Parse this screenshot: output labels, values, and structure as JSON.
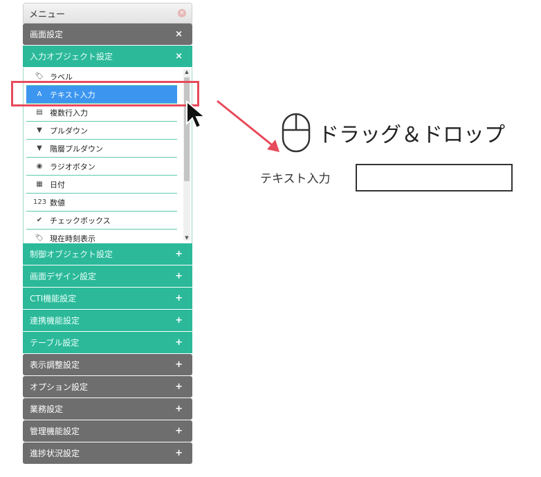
{
  "menu": {
    "title": "メニュー",
    "close_icon": "close-icon",
    "sections_top": [
      {
        "label": "画面設定",
        "sign": "×"
      },
      {
        "label": "入力オブジェクト設定",
        "sign": "×"
      }
    ],
    "input_objects": [
      {
        "label": "ラベル",
        "icon": "🏷"
      },
      {
        "label": "テキスト入力",
        "icon": "A"
      },
      {
        "label": "複数行入力",
        "icon": "▤"
      },
      {
        "label": "プルダウン",
        "icon": "▼"
      },
      {
        "label": "階層プルダウン",
        "icon": "▼"
      },
      {
        "label": "ラジオボタン",
        "icon": "◉"
      },
      {
        "label": "日付",
        "icon": "▦"
      },
      {
        "label": "数値",
        "icon": "123"
      },
      {
        "label": "チェックボックス",
        "icon": "✔"
      },
      {
        "label": "現在時刻表示",
        "icon": "🏷"
      }
    ],
    "teal_sections": [
      {
        "label": "制御オブジェクト設定",
        "sign": "+"
      },
      {
        "label": "画面デザイン設定",
        "sign": "+"
      },
      {
        "label": "CTI機能設定",
        "sign": "+"
      },
      {
        "label": "連携機能設定",
        "sign": "+"
      },
      {
        "label": "テーブル設定",
        "sign": "+"
      }
    ],
    "gray_sections": [
      {
        "label": "表示調整設定",
        "sign": "+"
      },
      {
        "label": "オプション設定",
        "sign": "+"
      },
      {
        "label": "業務設定",
        "sign": "+"
      },
      {
        "label": "管理機能設定",
        "sign": "+"
      },
      {
        "label": "進捗状況設定",
        "sign": "+"
      }
    ]
  },
  "drag_drop": {
    "label": "ドラッグ＆ドロップ",
    "icon": "mouse-icon"
  },
  "canvas": {
    "field_label": "テキスト入力",
    "field_value": ""
  },
  "colors": {
    "teal": "#2bb99a",
    "gray": "#6e6e6e",
    "selected": "#3c96f0",
    "highlight": "#e74a5a"
  }
}
